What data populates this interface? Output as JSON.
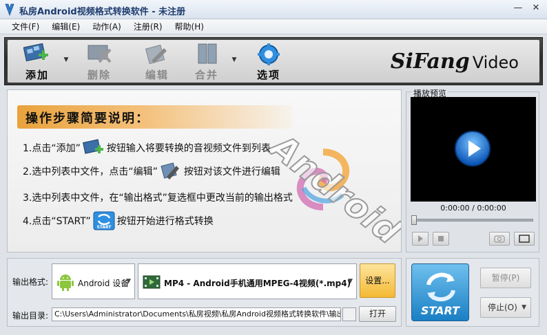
{
  "window": {
    "title": "私房Android视频格式转换软件  - 未注册",
    "minimize_glyph": "—",
    "close_glyph": "✕"
  },
  "menu": [
    {
      "label": "文件(F)"
    },
    {
      "label": "编辑(E)"
    },
    {
      "label": "动作(A)"
    },
    {
      "label": "注册(R)"
    },
    {
      "label": "帮助(H)"
    }
  ],
  "toolbar": {
    "add_label": "添加",
    "delete_label": "删除",
    "edit_label": "编辑",
    "merge_label": "合并",
    "options_label": "选项",
    "dropdown_glyph": "▼",
    "brand_main": "SiFang",
    "brand_sub": "Video"
  },
  "guide": {
    "title": "操作步骤简要说明：",
    "step1_a": "1.点击“添加”",
    "step1_b": "按钮输入将要转换的音视频文件到列表",
    "step2_a": "2.选中列表中文件，点击“编辑”",
    "step2_b": "按钮对该文件进行编辑",
    "step3": "3.选中列表中文件，在“输出格式”复选框中更改当前的输出格式",
    "step4_a": "4.点击“START”",
    "step4_b": "按钮开始进行格式转换",
    "start_icon_text": "START",
    "watermark": "Android"
  },
  "preview": {
    "label": "播放预览",
    "time": "0:00:00 / 0:00:00",
    "progress": 0
  },
  "output": {
    "format_label": "输出格式:",
    "device_value": "Android 设备",
    "format_value": "MP4 - Android手机通用MPEG-4视频(*.mp4)",
    "settings_label": "设置...",
    "dir_label": "输出目录:",
    "dir_value": "C:\\Users\\Administrator\\Documents\\私房视频\\私房Android视频格式转换软件\\输出\\",
    "open_label": "打开"
  },
  "controls": {
    "start_label": "START",
    "pause_label": "暂停(P)",
    "stop_label": "停止(O)"
  },
  "colors": {
    "accent_blue": "#1a7fc4",
    "settings_yellow": "#f4b934",
    "guide_orange": "#e8a23c"
  }
}
